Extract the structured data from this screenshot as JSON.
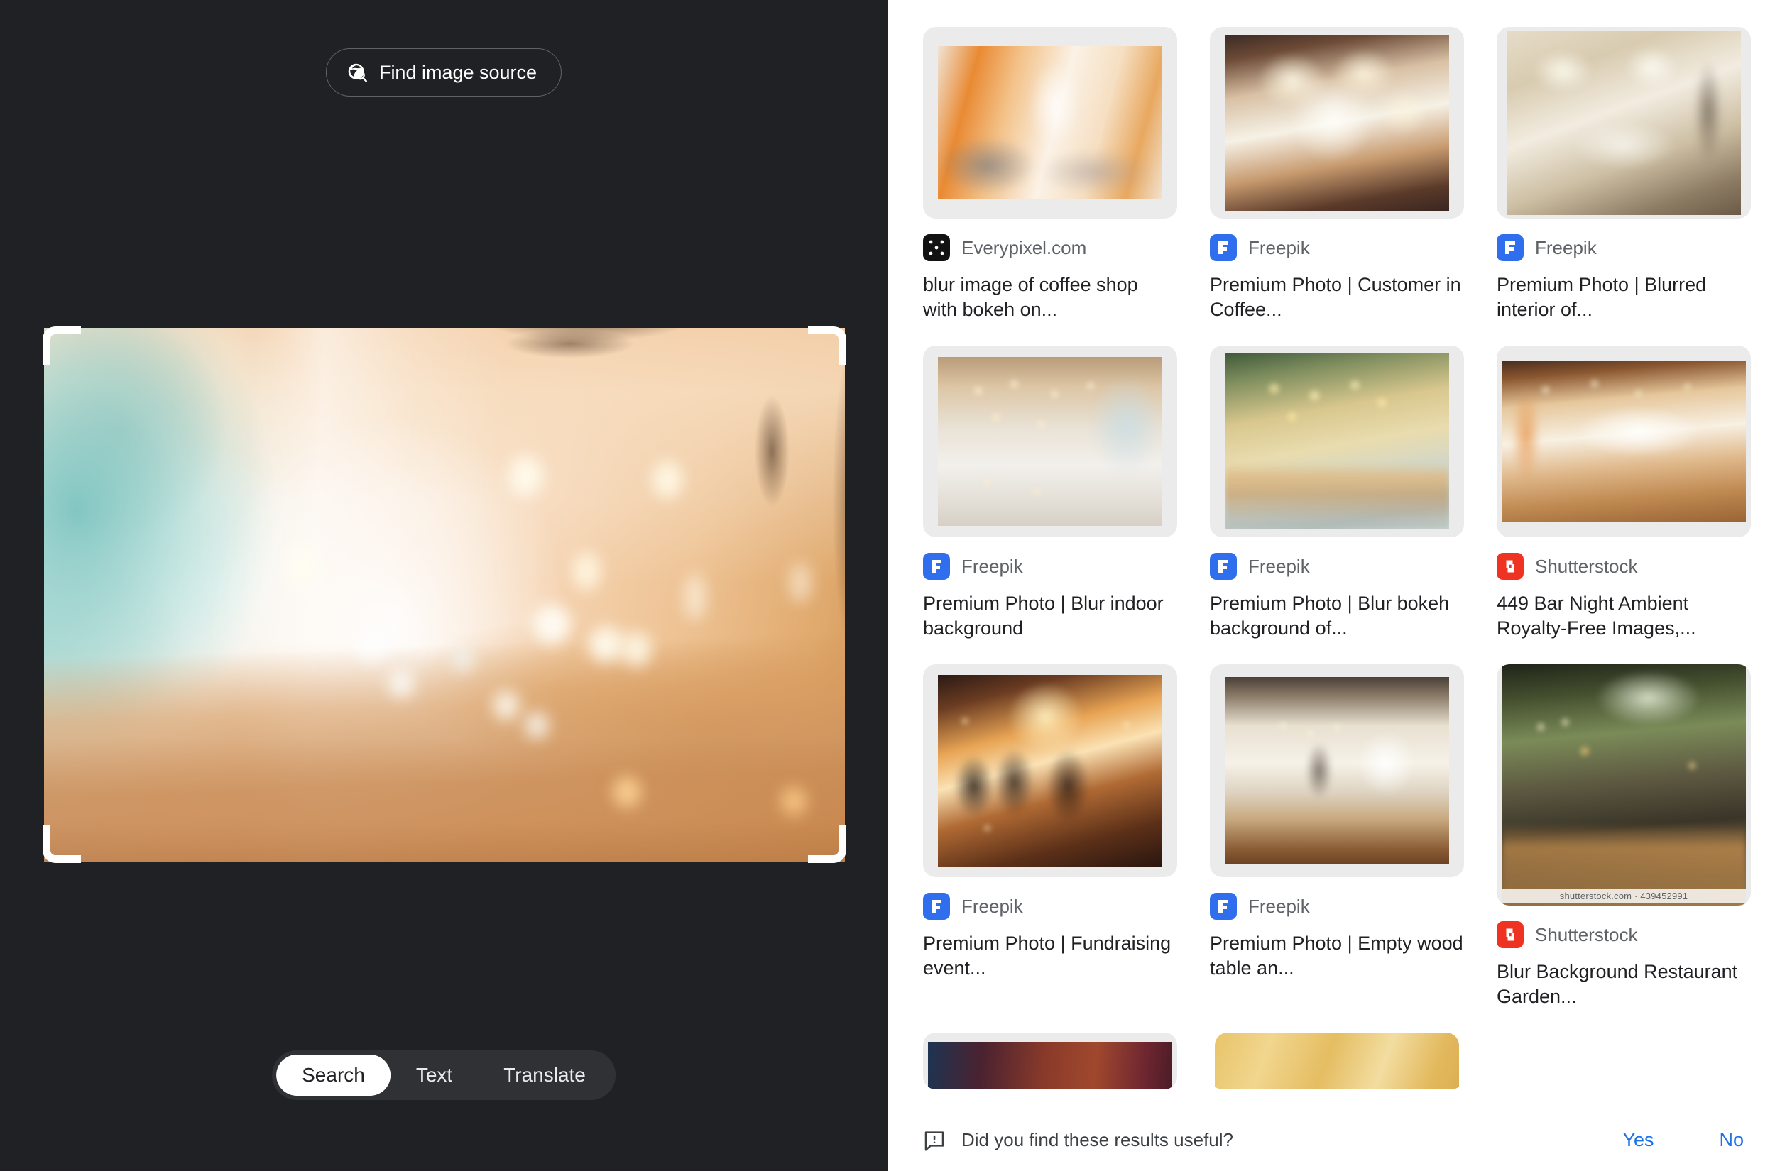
{
  "colors": {
    "dark_bg": "#202124",
    "panel_bg": "#ffffff",
    "accent_blue": "#1a73e8",
    "freepik_blue": "#2F6FED",
    "shutterstock_red": "#EE3322",
    "everypixel_black": "#121212",
    "thumb_tray": "#ebebeb",
    "muted_text": "#5f6368"
  },
  "left_panel": {
    "find_source_button": {
      "label": "Find image source",
      "icon": "image-source-search-icon"
    },
    "image": {
      "alt": "Blurred cafe interior with bokeh lights, wooden tables and a bright window",
      "crop_handles": [
        "top-left",
        "top-right",
        "bottom-left",
        "bottom-right"
      ]
    },
    "mode_tabs": [
      {
        "label": "Search",
        "active": true
      },
      {
        "label": "Text",
        "active": false
      },
      {
        "label": "Translate",
        "active": false
      }
    ]
  },
  "right_panel": {
    "results": [
      {
        "source": "Everypixel.com",
        "source_icon": "everypixel-icon",
        "title": "blur image of coffee shop with bokeh on...",
        "thumb": "coffee-shop-orange-pillar",
        "watermark": ""
      },
      {
        "source": "Freepik",
        "source_icon": "freepik-icon",
        "title": "Premium Photo | Customer in Coffee...",
        "thumb": "coffee-shop-dark-warm",
        "watermark": ""
      },
      {
        "source": "Freepik",
        "source_icon": "freepik-icon",
        "title": "Premium Photo | Blurred interior of...",
        "thumb": "restaurant-beige-tables",
        "watermark": ""
      },
      {
        "source": "Freepik",
        "source_icon": "freepik-icon",
        "title": "Premium Photo | Blur indoor background",
        "thumb": "reflective-floor-lights",
        "watermark": ""
      },
      {
        "source": "Freepik",
        "source_icon": "freepik-icon",
        "title": "Premium Photo | Blur bokeh background of...",
        "thumb": "cafe-table-chairs-bokeh",
        "watermark": ""
      },
      {
        "source": "Shutterstock",
        "source_icon": "shutterstock-icon",
        "title": "449 Bar Night Ambient Royalty-Free Images,...",
        "thumb": "warm-restaurant-corridor",
        "watermark": ""
      },
      {
        "source": "Freepik",
        "source_icon": "freepik-icon",
        "title": "Premium Photo | Fundraising event...",
        "thumb": "crowd-silhouettes-warm",
        "watermark": ""
      },
      {
        "source": "Freepik",
        "source_icon": "freepik-icon",
        "title": "Premium Photo | Empty wood table an...",
        "thumb": "empty-wood-table-patio",
        "watermark": ""
      },
      {
        "source": "Shutterstock",
        "source_icon": "shutterstock-icon",
        "title": "Blur Background Restaurant Garden...",
        "thumb": "garden-restaurant-dark",
        "watermark": "shutterstock.com · 439452991"
      },
      {
        "source": "",
        "source_icon": "",
        "title": "",
        "thumb": "partial-dark-red",
        "watermark": ""
      },
      {
        "source": "",
        "source_icon": "",
        "title": "",
        "thumb": "partial-gold",
        "watermark": ""
      }
    ],
    "feedback": {
      "icon": "feedback-icon",
      "question": "Did you find these results useful?",
      "yes_label": "Yes",
      "no_label": "No"
    }
  }
}
